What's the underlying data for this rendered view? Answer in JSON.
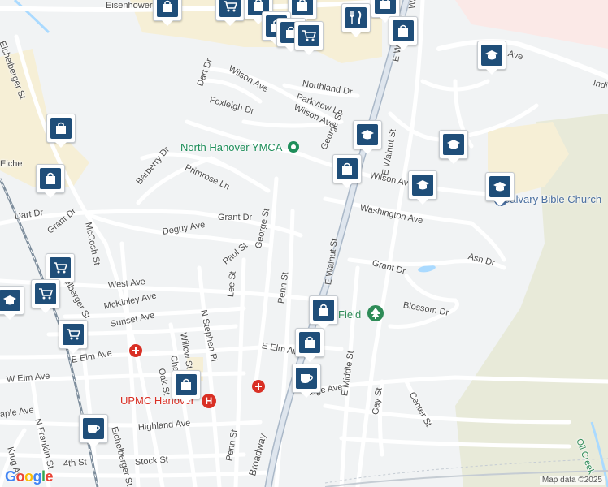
{
  "map": {
    "attribution": "Map data ©2025",
    "logo_letters": [
      "G",
      "o",
      "o",
      "g",
      "l",
      "e"
    ],
    "logo_colors": [
      "#4285f4",
      "#ea4335",
      "#fbbc05",
      "#4285f4",
      "#34a853",
      "#ea4335"
    ],
    "colors": {
      "background": "#f1f3f4",
      "road": "#ffffff",
      "highway": "#aab8c8",
      "railway": "#7d8d9c",
      "pin_fill": "#1f4e79",
      "park_label": "#2e8b57",
      "hospital": "#d93025",
      "water": "#aadaff",
      "commercial": "#f6efd6",
      "wooded": "#e8ead9"
    }
  },
  "street_labels": [
    "Eisenhower",
    "Eichelberger St",
    "Dart Dr",
    "Wilson Ave",
    "Northland Dr",
    "Foxleigh Dr",
    "Parkview Ln",
    "Wilson Ave",
    "George St",
    "E Walnut St",
    "E Walnut St",
    "Barberry Dr",
    "Primrose Ln",
    "Wilson Ave",
    "Washington Ave",
    "Dart Dr",
    "Grant Dr",
    "McCosh St",
    "Eichelberger St",
    "Deguy Ave",
    "Grant Dr",
    "George St",
    "Paul St",
    "Grant Dr",
    "Ash Dr",
    "E Walnut St",
    "West Ave",
    "Lee St",
    "Penn St",
    "McKinley Ave",
    "Blossom Dr",
    "Sunset Ave",
    "Willow St",
    "N Stephen Pl",
    "E Elm Ave",
    "E Elm Ave",
    "W Elm Ave",
    "Chas",
    "Oak St",
    "Broadway",
    "Highland Ave",
    "idge Ave",
    "E Middle St",
    "Gay St",
    "Center St",
    "N Franklin St",
    "aple Ave",
    "Krug Av",
    "Eichelberger St",
    "4th St",
    "Stock St",
    "Penn St",
    "Oil Creek",
    "Indi",
    "Ave",
    "Walnut",
    "Eiche"
  ],
  "places": {
    "ymca": "North Hanover YMCA",
    "calvary": "Calvary Bible Church",
    "field": "Field",
    "upmc": "UPMC Hanover"
  },
  "markers": [
    {
      "type": "shopping-bag"
    },
    {
      "type": "shopping-cart"
    },
    {
      "type": "shopping-bag"
    },
    {
      "type": "shopping-bag"
    },
    {
      "type": "shopping-bag"
    },
    {
      "type": "shopping-bag"
    },
    {
      "type": "shopping-cart"
    },
    {
      "type": "restaurant"
    },
    {
      "type": "shopping-bag"
    },
    {
      "type": "shopping-bag"
    },
    {
      "type": "school"
    },
    {
      "type": "school"
    },
    {
      "type": "school"
    },
    {
      "type": "shopping-bag"
    },
    {
      "type": "school"
    },
    {
      "type": "school"
    },
    {
      "type": "shopping-bag"
    },
    {
      "type": "shopping-bag"
    },
    {
      "type": "shopping-cart"
    },
    {
      "type": "shopping-cart"
    },
    {
      "type": "school"
    },
    {
      "type": "shopping-cart"
    },
    {
      "type": "shopping-bag"
    },
    {
      "type": "shopping-bag"
    },
    {
      "type": "shopping-bag"
    },
    {
      "type": "cafe"
    },
    {
      "type": "shopping-bag"
    },
    {
      "type": "cafe"
    }
  ]
}
